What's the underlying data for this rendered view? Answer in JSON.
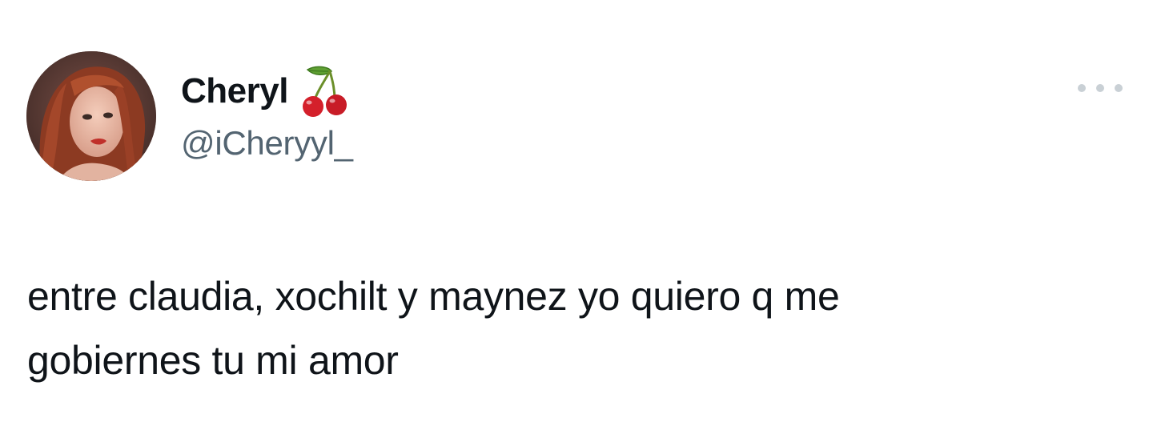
{
  "tweet": {
    "author": {
      "display_name": "Cheryl",
      "name_emoji": "cherry-icon",
      "handle": "@iCheryyl_",
      "avatar": "avatar-photo"
    },
    "more_icon": "more-horizontal-icon",
    "text_line_1": "entre claudia, xochilt y maynez yo quiero q me",
    "text_line_2": "gobiernes tu mi amor"
  },
  "colors": {
    "text_primary": "#0f1419",
    "text_secondary": "#536471",
    "more_dots": "#c9d0d5",
    "background": "#ffffff",
    "cherry_red": "#d4202b",
    "cherry_stem": "#6b8f2a"
  }
}
